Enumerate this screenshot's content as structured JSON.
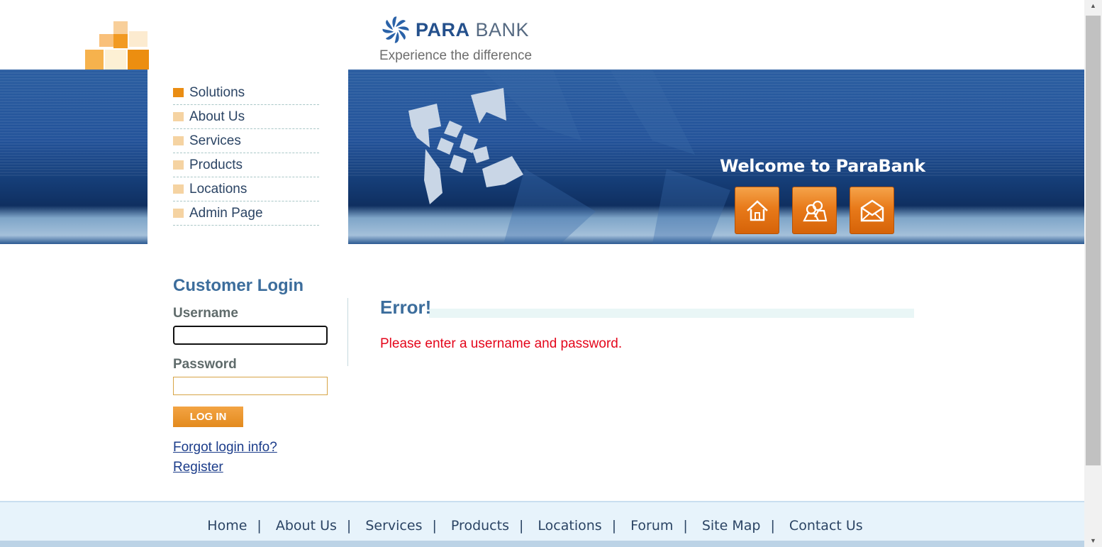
{
  "header": {
    "logo_para": "PARA",
    "logo_bank": "BANK",
    "tagline": "Experience the difference"
  },
  "banner": {
    "welcome": "Welcome to ParaBank",
    "buttons": [
      {
        "icon": "home-icon"
      },
      {
        "icon": "about-icon"
      },
      {
        "icon": "contact-icon"
      }
    ]
  },
  "nav": {
    "items": [
      {
        "label": "Solutions",
        "active": true
      },
      {
        "label": "About Us"
      },
      {
        "label": "Services"
      },
      {
        "label": "Products"
      },
      {
        "label": "Locations"
      },
      {
        "label": "Admin Page"
      }
    ]
  },
  "login": {
    "title": "Customer Login",
    "username_label": "Username",
    "username_value": "",
    "password_label": "Password",
    "password_value": "",
    "button": "LOG IN",
    "forgot": "Forgot login info?",
    "register": "Register"
  },
  "main": {
    "error_title": "Error!",
    "error_message": "Please enter a username and password."
  },
  "footer": {
    "links": [
      "Home",
      "About Us",
      "Services",
      "Products",
      "Locations",
      "Forum",
      "Site Map",
      "Contact Us"
    ]
  },
  "colors": {
    "accent_orange": "#ea8d13",
    "brand_blue": "#24508c",
    "error_red": "#e4061b"
  }
}
